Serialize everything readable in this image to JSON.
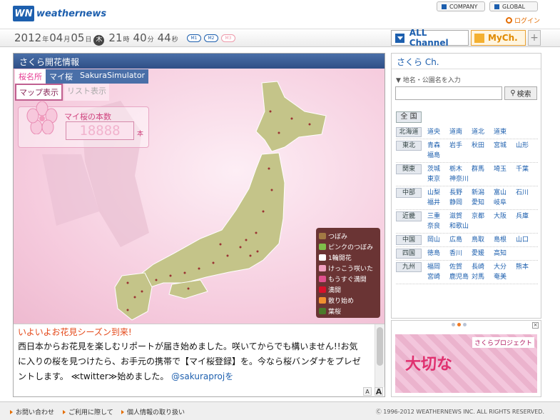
{
  "header": {
    "logo_mark": "WN",
    "logo_text": "weathernews",
    "company": "COMPANY",
    "global": "GLOBAL",
    "login": "ログイン"
  },
  "datebar": {
    "year": "2012",
    "year_unit": "年",
    "month": "04",
    "month_unit": "月",
    "day": "05",
    "day_unit": "日",
    "dow": "木",
    "hour": "21",
    "hour_unit": "時",
    "min": "40",
    "min_unit": "分",
    "sec": "44",
    "sec_unit": "秒",
    "m1": "M1",
    "m2": "M2",
    "m3": "M3",
    "all_channel": "ALL Channel",
    "mych": "MyCh.",
    "plus": "+"
  },
  "main": {
    "title": "さくら開花情報",
    "tabs": [
      "桜名所",
      "マイ桜",
      "SakuraSimulator"
    ],
    "view_tabs": [
      "マップ表示",
      "リスト表示"
    ],
    "counter_label": "マイ桜の本数",
    "counter_value": "18888",
    "counter_unit": "本",
    "legend": [
      {
        "label": "つぼみ",
        "color": "#a27a44"
      },
      {
        "label": "ピンクのつぼみ",
        "color": "#7fbf4a"
      },
      {
        "label": "1輪開花",
        "color": "#ffffff"
      },
      {
        "label": "けっこう咲いた",
        "color": "#f0a0c0"
      },
      {
        "label": "もうすぐ満開",
        "color": "#e0508e"
      },
      {
        "label": "満開",
        "color": "#d8102a"
      },
      {
        "label": "散り始め",
        "color": "#f09030"
      },
      {
        "label": "葉桜",
        "color": "#4a7a2a"
      }
    ],
    "message_head": "いよいよお花見シーズン到来!",
    "message_body": "西日本からお花見を楽しむリポートが届き始めました。咲いてからでも構いません!!お気に入りの桜を見つけたら、お手元の携帯で【マイ桜登録】を。今なら桜バンダナをプレゼントします。 ≪twitter≫始めました。",
    "message_link": "@sakuraprojを",
    "font_small": "A",
    "font_large": "A"
  },
  "side": {
    "title": "さくら Ch.",
    "search_label": "▼ 地名・公園名を入力",
    "search_placeholder": "",
    "search_button": "検索",
    "all_button": "全 国",
    "regions": [
      {
        "name": "北海道",
        "prefs": [
          "道央",
          "道南",
          "道北",
          "道東"
        ]
      },
      {
        "name": "東北",
        "prefs": [
          "青森",
          "岩手",
          "秋田",
          "宮城",
          "山形",
          "福島"
        ]
      },
      {
        "name": "関東",
        "prefs": [
          "茨城",
          "栃木",
          "群馬",
          "埼玉",
          "千葉",
          "東京",
          "神奈川"
        ]
      },
      {
        "name": "中部",
        "prefs": [
          "山梨",
          "長野",
          "新潟",
          "富山",
          "石川",
          "福井",
          "静岡",
          "愛知",
          "岐阜"
        ]
      },
      {
        "name": "近畿",
        "prefs": [
          "三重",
          "滋賀",
          "京都",
          "大阪",
          "兵庫",
          "奈良",
          "和歌山"
        ]
      },
      {
        "name": "中国",
        "prefs": [
          "岡山",
          "広島",
          "鳥取",
          "島根",
          "山口"
        ]
      },
      {
        "name": "四国",
        "prefs": [
          "徳島",
          "香川",
          "愛媛",
          "高知"
        ]
      },
      {
        "name": "九州",
        "prefs": [
          "福岡",
          "佐賀",
          "長崎",
          "大分",
          "熊本",
          "宮崎",
          "鹿児島",
          "対馬",
          "奄美"
        ]
      }
    ],
    "promo_tag": "さくらプロジェクト",
    "promo_big": "大切な"
  },
  "footer": {
    "links": [
      "お問い合わせ",
      "ご利用に際して",
      "個人情報の取り扱い"
    ],
    "copyright": "Ⓒ 1996-2012 WEATHERNEWS INC. ALL RIGHTS RESERVED."
  }
}
